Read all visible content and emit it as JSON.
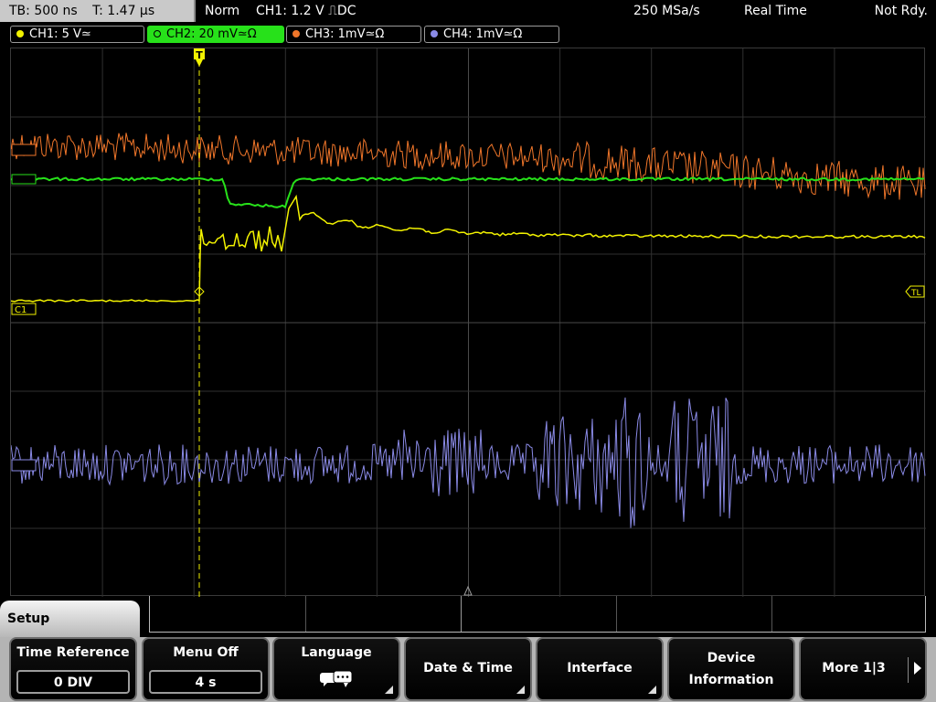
{
  "status": {
    "timebase": "TB: 500 ns",
    "trigger_time": "T: 1.47 µs",
    "trigger_mode": "Norm",
    "trigger_info": "CH1: 1.2 V ⎍DC",
    "sample_rate": "250 MSa/s",
    "acquisition_mode": "Real Time",
    "trigger_status": "Not Rdy."
  },
  "channels": [
    {
      "label": "CH1: 5 V≃",
      "color": "#f2f200"
    },
    {
      "label": "CH2: 20 mV≃Ω",
      "color": "#27e11a"
    },
    {
      "label": "CH3: 1mV≃Ω",
      "color": "#f0762a"
    },
    {
      "label": "CH4: 1mV≃Ω",
      "color": "#8a8ae6"
    }
  ],
  "markers": {
    "ch1": "C1",
    "trigger_level": "TL",
    "trigger_position": "T"
  },
  "menu": {
    "title": "Setup",
    "softkeys": [
      {
        "label": "Time Reference",
        "value": "0 DIV"
      },
      {
        "label": "Menu Off",
        "value": "4 s"
      },
      {
        "label": "Language",
        "icon": "speech-bubbles-icon"
      },
      {
        "label": "Date & Time"
      },
      {
        "label": "Interface"
      },
      {
        "label": "Device",
        "label2": "Information"
      },
      {
        "label": "More 1|3"
      }
    ]
  },
  "chart_data": {
    "type": "line",
    "grid": {
      "divisions_x": 10,
      "divisions_y": 8
    },
    "series": [
      {
        "name": "CH1",
        "color": "#f2f200"
      },
      {
        "name": "CH2",
        "color": "#27e11a"
      },
      {
        "name": "CH3",
        "color": "#f0762a"
      },
      {
        "name": "CH4",
        "color": "#8a8ae6"
      }
    ]
  }
}
